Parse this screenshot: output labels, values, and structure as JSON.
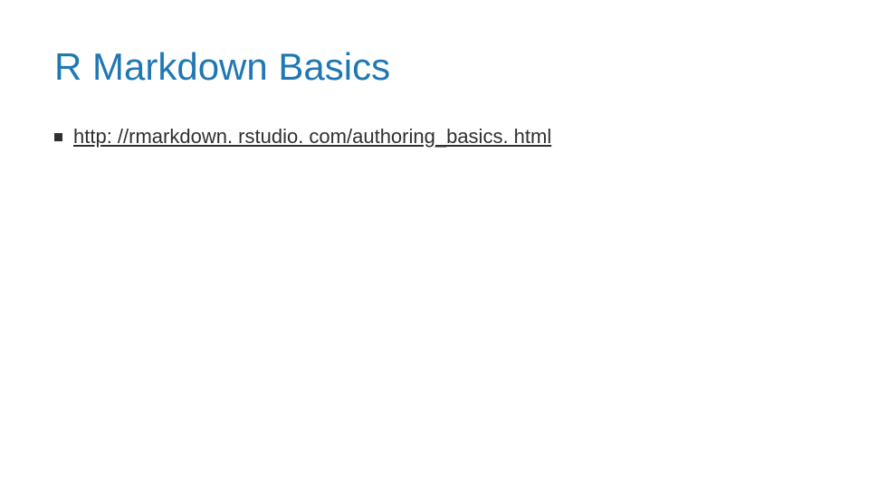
{
  "slide": {
    "title": "R Markdown Basics",
    "bullets": [
      {
        "text": "http: //rmarkdown. rstudio. com/authoring_basics. html"
      }
    ]
  }
}
